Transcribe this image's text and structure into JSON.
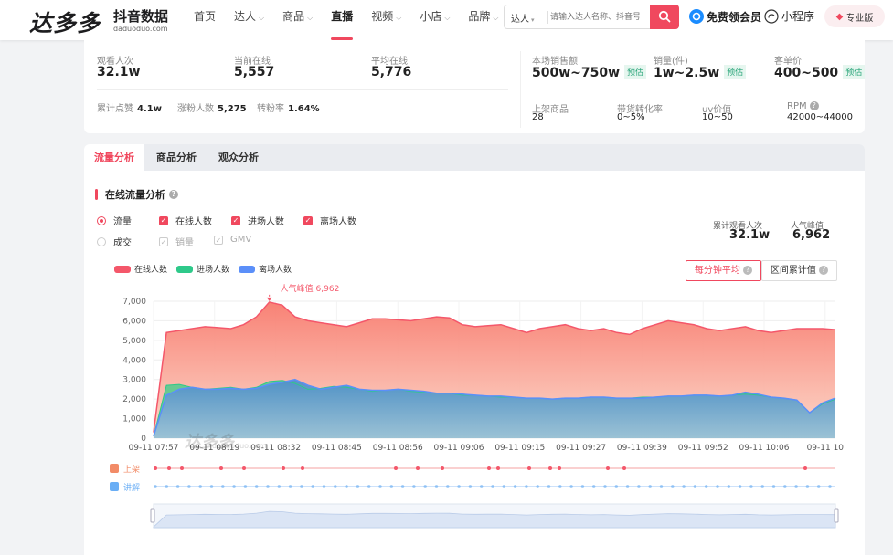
{
  "brand": {
    "name": "达多多",
    "sub": "抖音数据",
    "url": "daduoduo.com"
  },
  "nav": [
    {
      "label": "首页",
      "dropdown": false,
      "active": false
    },
    {
      "label": "达人",
      "dropdown": true,
      "active": false
    },
    {
      "label": "商品",
      "dropdown": true,
      "active": false
    },
    {
      "label": "直播",
      "dropdown": false,
      "active": true
    },
    {
      "label": "视频",
      "dropdown": true,
      "active": false
    },
    {
      "label": "小店",
      "dropdown": true,
      "active": false
    },
    {
      "label": "品牌",
      "dropdown": true,
      "active": false
    }
  ],
  "search": {
    "scope": "达人",
    "placeholder": "请输入达人名称、抖音号"
  },
  "header_actions": {
    "vip": "免费领会员",
    "mini": "小程序",
    "pro": "专业版"
  },
  "stats": {
    "viewers": {
      "label": "观看人次",
      "value": "32.1w"
    },
    "current_online": {
      "label": "当前在线",
      "value": "5,557"
    },
    "avg_online": {
      "label": "平均在线",
      "value": "5,776"
    },
    "likes": {
      "label": "累计点赞",
      "value": "4.1w"
    },
    "new_fans": {
      "label": "涨粉人数",
      "value": "5,275"
    },
    "convert": {
      "label": "转粉率",
      "value": "1.64%"
    },
    "sales_amount": {
      "label": "本场销售额",
      "value": "500w~750w",
      "badge": "预估"
    },
    "sales_count": {
      "label": "销量(件)",
      "value": "1w~2.5w",
      "badge": "预估"
    },
    "unit_price": {
      "label": "客单价",
      "value": "400~500",
      "badge": "预估"
    },
    "products": {
      "label": "上架商品",
      "value": "28"
    },
    "goods_rate": {
      "label": "带货转化率",
      "value": "0~5%"
    },
    "uv": {
      "label": "uv价值",
      "value": "10~50"
    },
    "rpm": {
      "label": "RPM",
      "value": "42000~44000"
    }
  },
  "tabs": [
    "流量分析",
    "商品分析",
    "观众分析"
  ],
  "section": {
    "title": "在线流量分析"
  },
  "controls": {
    "flow": "流量",
    "online": "在线人数",
    "enter": "进场人数",
    "leave": "离场人数",
    "deal": "成交",
    "sales": "销量",
    "gmv": "GMV"
  },
  "side": {
    "total_label": "累计观看人次",
    "total_value": "32.1w",
    "peak_label": "人气峰值",
    "peak_value": "6,962"
  },
  "toggle": {
    "per_min": "每分钟平均",
    "range": "区间累计值"
  },
  "timeline": {
    "shelf": "上架",
    "explain": "讲解"
  },
  "watermark": {
    "text": "达多多",
    "url": "daduoduo.com"
  },
  "colors": {
    "accent": "#f0485e",
    "online": "#f4576a",
    "enter": "#2ec98a",
    "leave": "#5b8ff9"
  },
  "chart_data": {
    "type": "area",
    "legend": [
      "在线人数",
      "进场人数",
      "离场人数"
    ],
    "x_ticks": [
      "09-11 07:57",
      "09-11 08:19",
      "09-11 08:32",
      "09-11 08:45",
      "09-11 08:56",
      "09-11 09:06",
      "09-11 09:15",
      "09-11 09:27",
      "09-11 09:39",
      "09-11 09:52",
      "09-11 10:06",
      "09-11 10"
    ],
    "ylim": [
      0,
      7000
    ],
    "y_ticks": [
      0,
      1000,
      2000,
      3000,
      4000,
      5000,
      6000,
      7000
    ],
    "peak": {
      "label": "人气峰值",
      "value": 6962
    },
    "series": [
      {
        "name": "在线人数",
        "values": [
          300,
          5400,
          5500,
          5600,
          5700,
          5650,
          5600,
          5800,
          6200,
          6960,
          6800,
          6200,
          6000,
          5900,
          5800,
          5700,
          5900,
          6100,
          6100,
          6050,
          6000,
          6100,
          6200,
          6150,
          5800,
          5700,
          5750,
          5800,
          5600,
          5400,
          5600,
          5700,
          5800,
          5600,
          5500,
          5600,
          5400,
          5300,
          5600,
          5800,
          6000,
          5900,
          5800,
          5600,
          5500,
          5600,
          5700,
          5500,
          5400,
          5500,
          5600,
          5600,
          5600,
          5550
        ]
      },
      {
        "name": "进场人数",
        "values": [
          100,
          2700,
          2750,
          2600,
          2500,
          2550,
          2600,
          2500,
          2600,
          2900,
          2950,
          2800,
          2500,
          2550,
          2650,
          2600,
          2500,
          2400,
          2450,
          2500,
          2400,
          2350,
          2300,
          2300,
          2200,
          2200,
          2150,
          2100,
          2100,
          2050,
          2050,
          2000,
          2050,
          2050,
          2100,
          2100,
          2050,
          2050,
          2100,
          2100,
          2150,
          2150,
          2200,
          2200,
          2150,
          2200,
          2250,
          2200,
          2100,
          2050,
          1950,
          1300,
          1750,
          2000
        ]
      },
      {
        "name": "离场人数",
        "values": [
          100,
          2200,
          2500,
          2600,
          2500,
          2500,
          2550,
          2500,
          2550,
          2750,
          2850,
          3000,
          2700,
          2500,
          2600,
          2700,
          2500,
          2450,
          2450,
          2500,
          2450,
          2400,
          2300,
          2300,
          2250,
          2200,
          2150,
          2150,
          2100,
          2050,
          2050,
          2000,
          2050,
          2050,
          2100,
          2100,
          2050,
          2050,
          2050,
          2100,
          2150,
          2150,
          2200,
          2200,
          2150,
          2200,
          2350,
          2250,
          2100,
          2050,
          1950,
          1300,
          1800,
          2050
        ]
      }
    ],
    "grid": true
  }
}
